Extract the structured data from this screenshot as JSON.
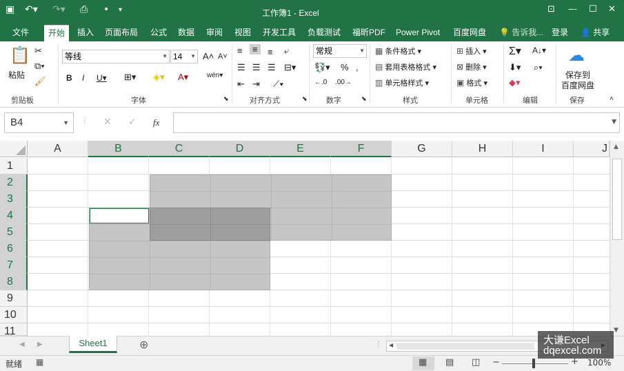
{
  "window": {
    "title": "工作簿1 - Excel"
  },
  "tabs": [
    "文件",
    "开始",
    "插入",
    "页面布局",
    "公式",
    "数据",
    "审阅",
    "视图",
    "开发工具",
    "负载测试",
    "福昕PDF",
    "Power Pivot",
    "百度网盘"
  ],
  "tell_me": "告诉我...",
  "login": "登录",
  "share": "共享",
  "ribbon": {
    "clipboard": {
      "paste": "粘贴",
      "label": "剪贴板"
    },
    "font": {
      "name": "等线",
      "size": "14",
      "label": "字体"
    },
    "align": {
      "label": "对齐方式"
    },
    "number": {
      "format": "常规",
      "label": "数字"
    },
    "styles": {
      "cond": "条件格式",
      "table": "套用表格格式",
      "cell": "单元格样式",
      "label": "样式"
    },
    "cells": {
      "insert": "插入",
      "delete": "删除",
      "format": "格式",
      "label": "单元格"
    },
    "edit": {
      "label": "编辑"
    },
    "save": {
      "line1": "保存到",
      "line2": "百度网盘",
      "label": "保存"
    }
  },
  "namebox": "B4",
  "fx": "fx",
  "columns": [
    "A",
    "B",
    "C",
    "D",
    "E",
    "F",
    "G",
    "H",
    "I",
    "J"
  ],
  "rows": [
    "1",
    "2",
    "3",
    "4",
    "5",
    "6",
    "7",
    "8",
    "9",
    "10",
    "11"
  ],
  "sheet": "Sheet1",
  "status": {
    "ready": "就绪",
    "zoom": "100%"
  },
  "watermark": {
    "line1": "大谦Excel",
    "line2": "dqexcel.com"
  },
  "colors": {
    "accent": "#217346",
    "selection": "#c6c6c6",
    "overlap": "#9e9e9e"
  }
}
